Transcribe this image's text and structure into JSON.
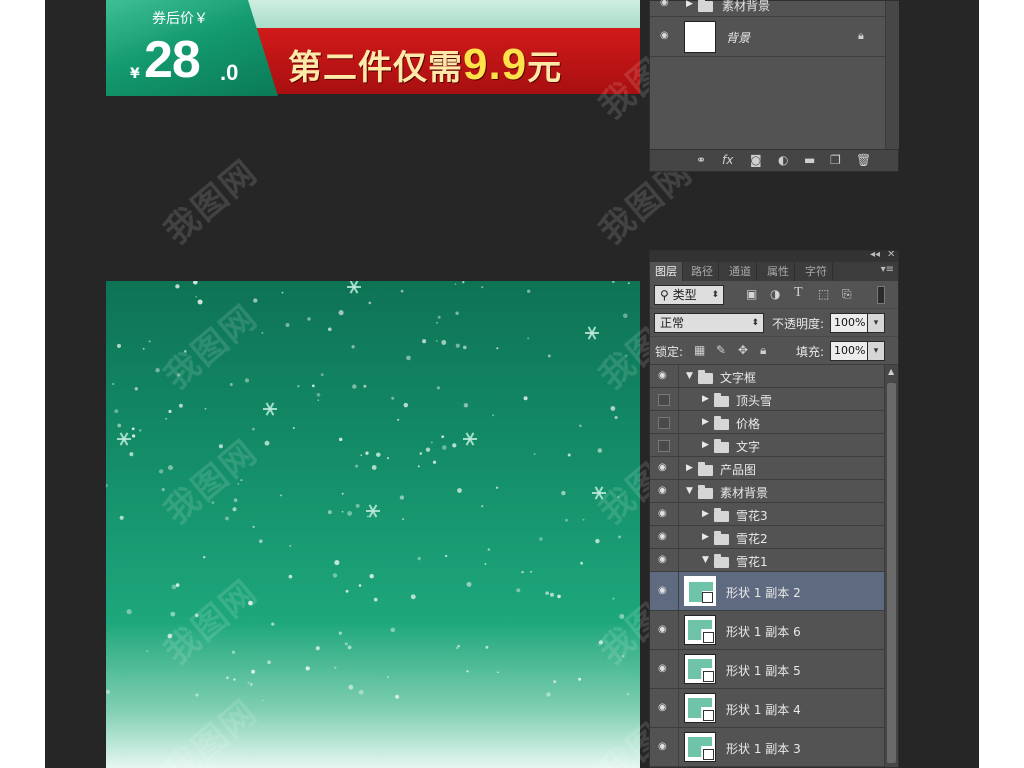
{
  "banner": {
    "coupon_label": "券后价￥",
    "currency": "¥",
    "price_int": "28",
    "price_dec": ".0",
    "promo_prefix": "第二件仅需",
    "promo_number": "9.9",
    "promo_suffix": "元",
    "colors": {
      "green": "#149a70",
      "red": "#c41414",
      "gold": "#ffe24a"
    }
  },
  "watermark": {
    "text": "我图网"
  },
  "top_panel": {
    "rows": [
      {
        "name": "素材背景",
        "type": "group"
      },
      {
        "name": "背景",
        "type": "background",
        "locked": true
      }
    ],
    "footer_icons": [
      "link-icon",
      "fx-icon",
      "mask-icon",
      "adjustment-icon",
      "new-group-icon",
      "new-layer-icon",
      "trash-icon"
    ]
  },
  "layers_panel": {
    "tabs": [
      "图层",
      "路径",
      "通道",
      "属性",
      "字符"
    ],
    "active_tab": "图层",
    "filter": {
      "value": "类型",
      "icons": [
        "image-filter-icon",
        "adjustment-filter-icon",
        "type-filter-icon",
        "shape-filter-icon",
        "smart-object-filter-icon"
      ]
    },
    "blend_mode": "正常",
    "opacity_label": "不透明度:",
    "opacity_value": "100%",
    "lock_label": "锁定:",
    "fill_label": "填充:",
    "fill_value": "100%",
    "layers": [
      {
        "name": "文字框",
        "indent": 0,
        "expanded": true,
        "visible": true,
        "type": "group"
      },
      {
        "name": "顶头雪",
        "indent": 1,
        "expanded": false,
        "visible": false,
        "type": "group"
      },
      {
        "name": "价格",
        "indent": 1,
        "expanded": false,
        "visible": false,
        "type": "group"
      },
      {
        "name": "文字",
        "indent": 1,
        "expanded": false,
        "visible": false,
        "type": "group"
      },
      {
        "name": "产品图",
        "indent": 0,
        "expanded": false,
        "visible": true,
        "type": "group"
      },
      {
        "name": "素材背景",
        "indent": 0,
        "expanded": true,
        "visible": true,
        "type": "group"
      },
      {
        "name": "雪花3",
        "indent": 1,
        "expanded": false,
        "visible": true,
        "type": "group"
      },
      {
        "name": "雪花2",
        "indent": 1,
        "expanded": false,
        "visible": true,
        "type": "group"
      },
      {
        "name": "雪花1",
        "indent": 1,
        "expanded": true,
        "visible": true,
        "type": "group"
      },
      {
        "name": "形状 1 副本 2",
        "indent": 2,
        "visible": true,
        "type": "shape",
        "selected": true
      },
      {
        "name": "形状 1 副本 6",
        "indent": 2,
        "visible": true,
        "type": "shape"
      },
      {
        "name": "形状 1 副本 5",
        "indent": 2,
        "visible": true,
        "type": "shape"
      },
      {
        "name": "形状 1 副本 4",
        "indent": 2,
        "visible": true,
        "type": "shape"
      },
      {
        "name": "形状 1 副本 3",
        "indent": 2,
        "visible": true,
        "type": "shape"
      }
    ]
  }
}
